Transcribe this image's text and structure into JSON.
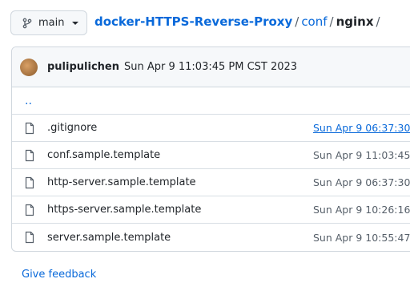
{
  "branch": {
    "name": "main",
    "icon": "git-branch-icon"
  },
  "breadcrumb": {
    "repo": "docker-HTTPS-Reverse-Proxy",
    "sep1": "/",
    "seg1": "conf",
    "sep2": "/",
    "current": "nginx",
    "sep3": "/"
  },
  "latest_commit": {
    "author": "pulipulichen",
    "date": "Sun Apr 9 11:03:45 PM CST 2023"
  },
  "parent_dir": "..",
  "files": [
    {
      "name": ".gitignore",
      "date": "Sun Apr 9 06:37:30",
      "icon": "file-icon"
    },
    {
      "name": "conf.sample.template",
      "date": "Sun Apr 9 11:03:45",
      "icon": "file-icon"
    },
    {
      "name": "http-server.sample.template",
      "date": "Sun Apr 9 06:37:30",
      "icon": "file-icon"
    },
    {
      "name": "https-server.sample.template",
      "date": "Sun Apr 9 10:26:16",
      "icon": "file-icon"
    },
    {
      "name": "server.sample.template",
      "date": "Sun Apr 9 10:55:47",
      "icon": "file-icon"
    }
  ],
  "feedback_label": "Give feedback",
  "colors": {
    "link": "#0969da",
    "border": "#d0d7de",
    "muted": "#57606a"
  }
}
